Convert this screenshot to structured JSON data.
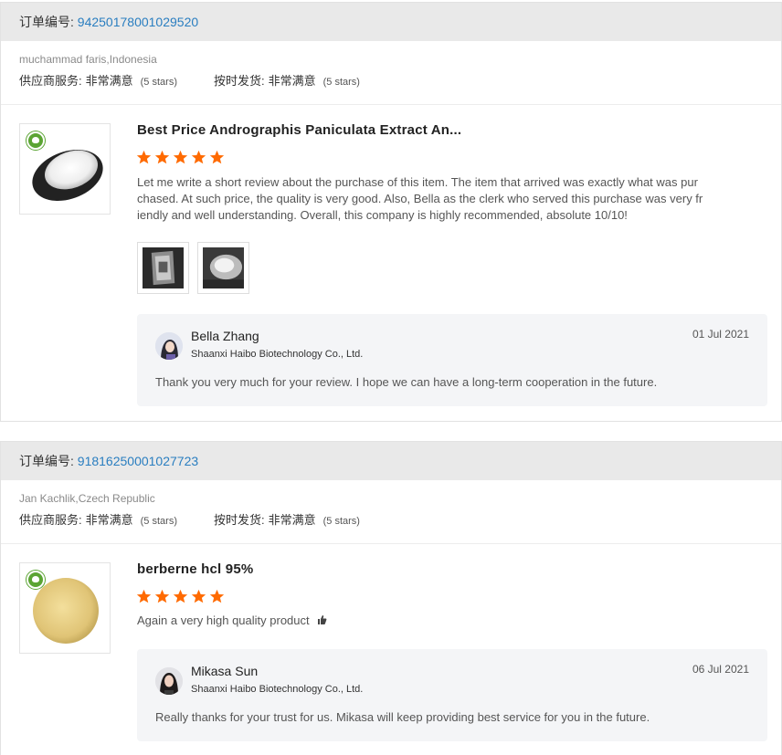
{
  "orders": [
    {
      "order_label": "订单编号:",
      "order_number": "94250178001029520",
      "buyer": "muchammad faris,Indonesia",
      "ratings": [
        {
          "label": "供应商服务:",
          "value": "非常满意",
          "stars_text": "(5 stars)"
        },
        {
          "label": "按时发货:",
          "value": "非常满意",
          "stars_text": "(5 stars)"
        }
      ],
      "product_title": "Best Price Andrographis Paniculata Extract An...",
      "star_rating": 5,
      "review_lines": [
        "Let me write a short review about the purchase of this item. The item that arrived was exactly what was pur",
        "chased. At such price, the quality is very good. Also, Bella as the clerk who served this purchase was very fr",
        "iendly and well understanding. Overall, this company is highly recommended, absolute 10/10!"
      ],
      "reply": {
        "agent": "Bella Zhang",
        "company": "Shaanxi Haibo Biotechnology Co., Ltd.",
        "date": "01 Jul 2021",
        "text": "Thank you very much for your review. I hope we can have a long-term cooperation in the future."
      }
    },
    {
      "order_label": "订单编号:",
      "order_number": "91816250001027723",
      "buyer": "Jan Kachlik,Czech Republic",
      "ratings": [
        {
          "label": "供应商服务:",
          "value": "非常满意",
          "stars_text": "(5 stars)"
        },
        {
          "label": "按时发货:",
          "value": "非常满意",
          "stars_text": "(5 stars)"
        }
      ],
      "product_title": "berberne hcl 95%",
      "star_rating": 5,
      "review_lines": [
        "Again a very high quality product"
      ],
      "reply": {
        "agent": "Mikasa Sun",
        "company": "Shaanxi Haibo Biotechnology Co., Ltd.",
        "date": "06 Jul 2021",
        "text": "Really thanks for your trust for us. Mikasa will keep providing best service for you in the future."
      }
    }
  ],
  "icons": {
    "star": "star-icon",
    "thumbs_up": "thumbs-up-icon",
    "badge": "leaf-badge-icon"
  },
  "colors": {
    "star": "#ff6a00",
    "link": "#2a7ec0",
    "header_bg": "#e9e9e9",
    "reply_bg": "#f4f5f7",
    "badge": "#5ba433"
  }
}
